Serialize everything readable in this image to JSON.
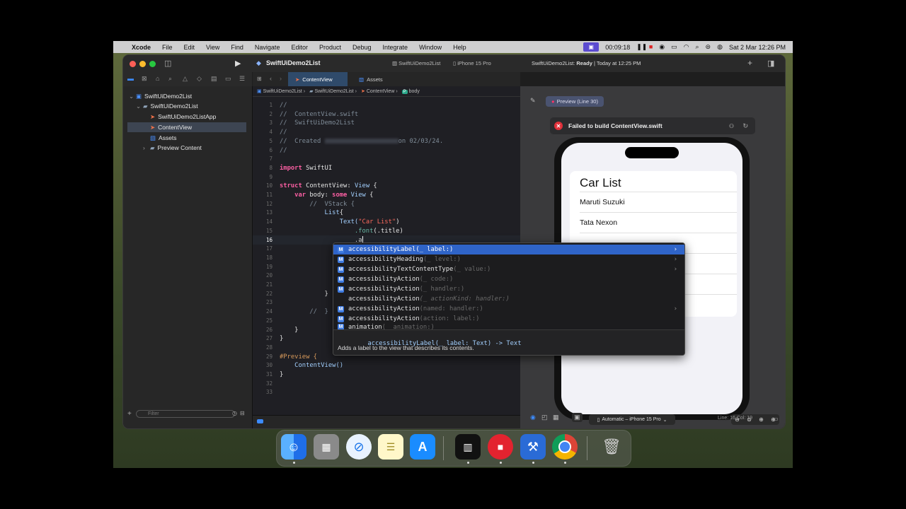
{
  "menubar": {
    "apple": "",
    "app": "Xcode",
    "items": [
      "File",
      "Edit",
      "View",
      "Find",
      "Navigate",
      "Editor",
      "Product",
      "Debug",
      "Integrate",
      "Window",
      "Help"
    ],
    "timer": "00:09:18",
    "datetime": "Sat 2 Mar  12:26 PM"
  },
  "toolbar": {
    "project": "SwiftUiDemo2List",
    "scheme": "SwiftUiDemo2List",
    "destination": "iPhone 15 Pro",
    "status_project": "SwiftUiDemo2List:",
    "status_state": "Ready",
    "status_time": "| Today at 12:25 PM"
  },
  "navigator": {
    "items": [
      {
        "label": "SwiftUiDemo2List",
        "icon": "project-icon"
      },
      {
        "label": "SwiftUiDemo2List",
        "icon": "folder-icon"
      },
      {
        "label": "SwiftUiDemo2ListApp",
        "icon": "swift-file-icon"
      },
      {
        "label": "ContentView",
        "icon": "swift-file-icon"
      },
      {
        "label": "Assets",
        "icon": "assets-icon"
      },
      {
        "label": "Preview Content",
        "icon": "folder-icon"
      }
    ],
    "filter_placeholder": "Filter"
  },
  "editor": {
    "tabs": [
      "ContentView",
      "Assets"
    ],
    "breadcrumb": [
      "SwiftUiDemo2List",
      "SwiftUiDemo2List",
      "ContentView",
      "body"
    ],
    "cursor": "Line: 16  Col: 19",
    "code": {
      "l1": "//",
      "l2": "//  ContentView.swift",
      "l3": "//  SwiftUiDemo2List",
      "l4": "//",
      "l5a": "//  Created ",
      "l5b": "on 02/03/24.",
      "l6": "//",
      "l8a": "import",
      "l8b": " SwiftUI",
      "l10a": "struct",
      "l10b": " ContentView: ",
      "l10c": "View",
      "l10d": " {",
      "l11a": "    var",
      "l11b": " body: ",
      "l11c": "some",
      "l11d": " View",
      "l11e": " {",
      "l12": "        //  VStack {",
      "l13a": "            List",
      "l13b": "{",
      "l14a": "                Text(",
      "l14b": "\"Car List\"",
      "l14c": ")",
      "l15a": "                    .font",
      "l15b": "(.title)",
      "l16": "                    .a",
      "l17": "                T",
      "l18": "                T",
      "l19": "                T",
      "l20": "                T",
      "l21": "                T",
      "l22": "            }",
      "l24": "        //  }",
      "l26": "    }",
      "l27": "}",
      "l29": "#Preview {",
      "l30": "    ContentView()",
      "l31": "}"
    }
  },
  "completion": {
    "items": [
      {
        "name": "accessibilityLabel",
        "rest": "(_ label:)",
        "badge": "M"
      },
      {
        "name": "accessibilityHeading",
        "rest": "(_ level:)",
        "badge": "M"
      },
      {
        "name": "accessibilityTextContentType",
        "rest": "(_ value:)",
        "badge": "M"
      },
      {
        "name": "accessibilityAction",
        "rest": "(_ code:)",
        "badge": "M"
      },
      {
        "name": "accessibilityAction",
        "rest": "(_ handler:)",
        "badge": "M"
      },
      {
        "name": "accessibilityAction",
        "rest": "(_ actionKind: handler:)",
        "badge": ""
      },
      {
        "name": "accessibilityAction",
        "rest": "(named: handler:)",
        "badge": "M"
      },
      {
        "name": "accessibilityAction",
        "rest": "(action: label:)",
        "badge": "M"
      },
      {
        "name": "animation",
        "rest": "(_ animation:)",
        "badge": "M"
      }
    ],
    "signature": "accessibilityLabel(_ label: Text) -> Text",
    "description": "Adds a label to the view that describes its contents."
  },
  "preview": {
    "pin_label": "Preview (Line 30)",
    "error": "Failed to build ContentView.swift",
    "list_title": "Car List",
    "rows": [
      "Maruti Suzuki",
      "Tata Nexon"
    ],
    "device": "Automatic – iPhone 15 Pro"
  },
  "dock": [
    "finder-icon",
    "launchpad-icon",
    "safari-icon",
    "notes-icon",
    "app-store-icon",
    "piano-icon",
    "recorder-icon",
    "xcode-icon",
    "chrome-icon",
    "trash-icon"
  ]
}
